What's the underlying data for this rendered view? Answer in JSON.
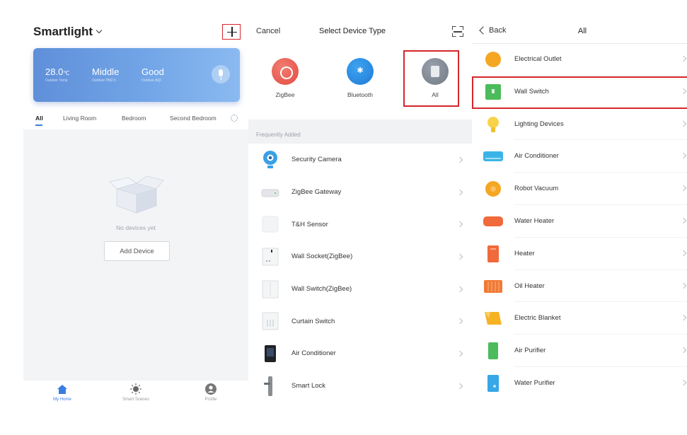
{
  "home": {
    "title": "Smartlight",
    "weather": {
      "temp": "28.0",
      "temp_unit": "℃",
      "temp_sub": "Outdoor Temp",
      "pm": "Middle",
      "pm_sub": "Outdoor PM2.5",
      "air": "Good",
      "air_sub": "Outdoor AQI"
    },
    "rooms": [
      "All",
      "Living Room",
      "Bedroom",
      "Second Bedroom"
    ],
    "empty_text": "No devices yet",
    "add_device": "Add Device",
    "nav": [
      "My Home",
      "Smart Scenes",
      "Profile"
    ],
    "colors": {
      "accent": "#3a7de0",
      "highlight": "#d6262c"
    }
  },
  "select_type": {
    "cancel": "Cancel",
    "title": "Select Device Type",
    "types": [
      {
        "label": "ZigBee",
        "icon": "zigbee-icon",
        "color": "#e2493f"
      },
      {
        "label": "Bluetooth",
        "icon": "bluetooth-icon",
        "color": "#1d7bd8"
      },
      {
        "label": "All",
        "icon": "all-devices-icon",
        "color": "#6f7883"
      }
    ],
    "frequently_added_label": "Frequently Added",
    "frequent": [
      {
        "label": "Security Camera",
        "icon": "camera-icon"
      },
      {
        "label": "ZigBee Gateway",
        "icon": "gateway-icon"
      },
      {
        "label": "T&H Sensor",
        "icon": "sensor-icon"
      },
      {
        "label": "Wall Socket(ZigBee)",
        "icon": "wall-socket-icon"
      },
      {
        "label": "Wall Switch(ZigBee)",
        "icon": "wall-switch-icon"
      },
      {
        "label": "Curtain Switch",
        "icon": "curtain-switch-icon"
      },
      {
        "label": "Air Conditioner",
        "icon": "ac-controller-icon"
      },
      {
        "label": "Smart Lock",
        "icon": "smart-lock-icon"
      }
    ]
  },
  "all_list": {
    "back": "Back",
    "title": "All",
    "items": [
      {
        "label": "Electrical Outlet",
        "icon": "outlet-icon",
        "color": "#f5a623"
      },
      {
        "label": "Wall Switch",
        "icon": "wall-switch-icon",
        "color": "#4cbb5b"
      },
      {
        "label": "Lighting Devices",
        "icon": "bulb-icon",
        "color": "#f8d34a"
      },
      {
        "label": "Air Conditioner",
        "icon": "ac-icon",
        "color": "#3ab4e8"
      },
      {
        "label": "Robot Vacuum",
        "icon": "vacuum-icon",
        "color": "#f5a623"
      },
      {
        "label": "Water Heater",
        "icon": "water-heater-icon",
        "color": "#f06a3c"
      },
      {
        "label": "Heater",
        "icon": "heater-icon",
        "color": "#f06a3c"
      },
      {
        "label": "Oil Heater",
        "icon": "oil-heater-icon",
        "color": "#f07a34"
      },
      {
        "label": "Electric Blanket",
        "icon": "blanket-icon",
        "color": "#f5b323"
      },
      {
        "label": "Air Purifier",
        "icon": "purifier-icon",
        "color": "#4cbb5b"
      },
      {
        "label": "Water Purifier",
        "icon": "water-purifier-icon",
        "color": "#37a7e8"
      }
    ]
  }
}
